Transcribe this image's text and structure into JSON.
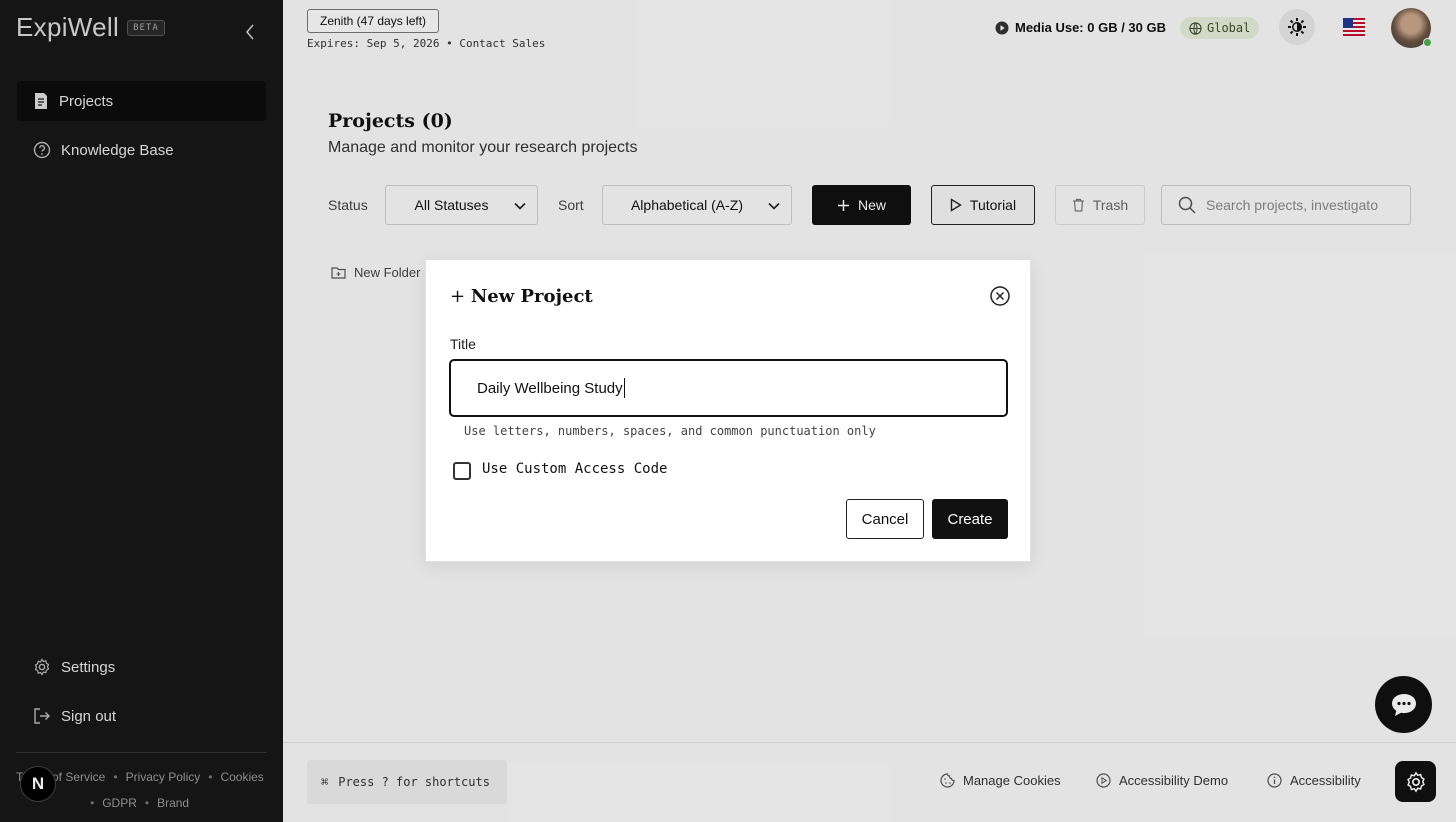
{
  "sidebar": {
    "logo": "ExpiWell",
    "beta": "BETA",
    "items": [
      {
        "label": "Projects"
      },
      {
        "label": "Knowledge Base"
      }
    ],
    "settings": "Settings",
    "sign_out": "Sign out",
    "footer_links": [
      "Terms of Service",
      "Privacy Policy",
      "Cookies",
      "GDPR",
      "Brand"
    ],
    "badge": "N"
  },
  "header": {
    "plan": "Zenith (47 days left)",
    "expires": "Expires: Sep 5, 2026 • Contact Sales",
    "media_use": "Media Use: 0 GB / 30 GB",
    "region": "Global"
  },
  "page": {
    "title": "Projects (0)",
    "subtitle": "Manage and monitor your research projects",
    "status_label": "Status",
    "status_value": "All Statuses",
    "sort_label": "Sort",
    "sort_value": "Alphabetical (A-Z)",
    "new_label": "New",
    "tutorial_label": "Tutorial",
    "trash_label": "Trash",
    "search_placeholder": "Search projects, investigato",
    "new_folder": "New Folder"
  },
  "footer": {
    "shortcut": "Press ? for shortcuts",
    "manage_cookies": "Manage Cookies",
    "accessibility_demo": "Accessibility Demo",
    "accessibility": "Accessibility"
  },
  "modal": {
    "title": "New Project",
    "title_label": "Title",
    "title_value": "Daily Wellbeing Study",
    "hint": "Use letters, numbers, spaces, and common punctuation only",
    "checkbox_label": "Use Custom Access Code",
    "cancel": "Cancel",
    "create": "Create"
  }
}
